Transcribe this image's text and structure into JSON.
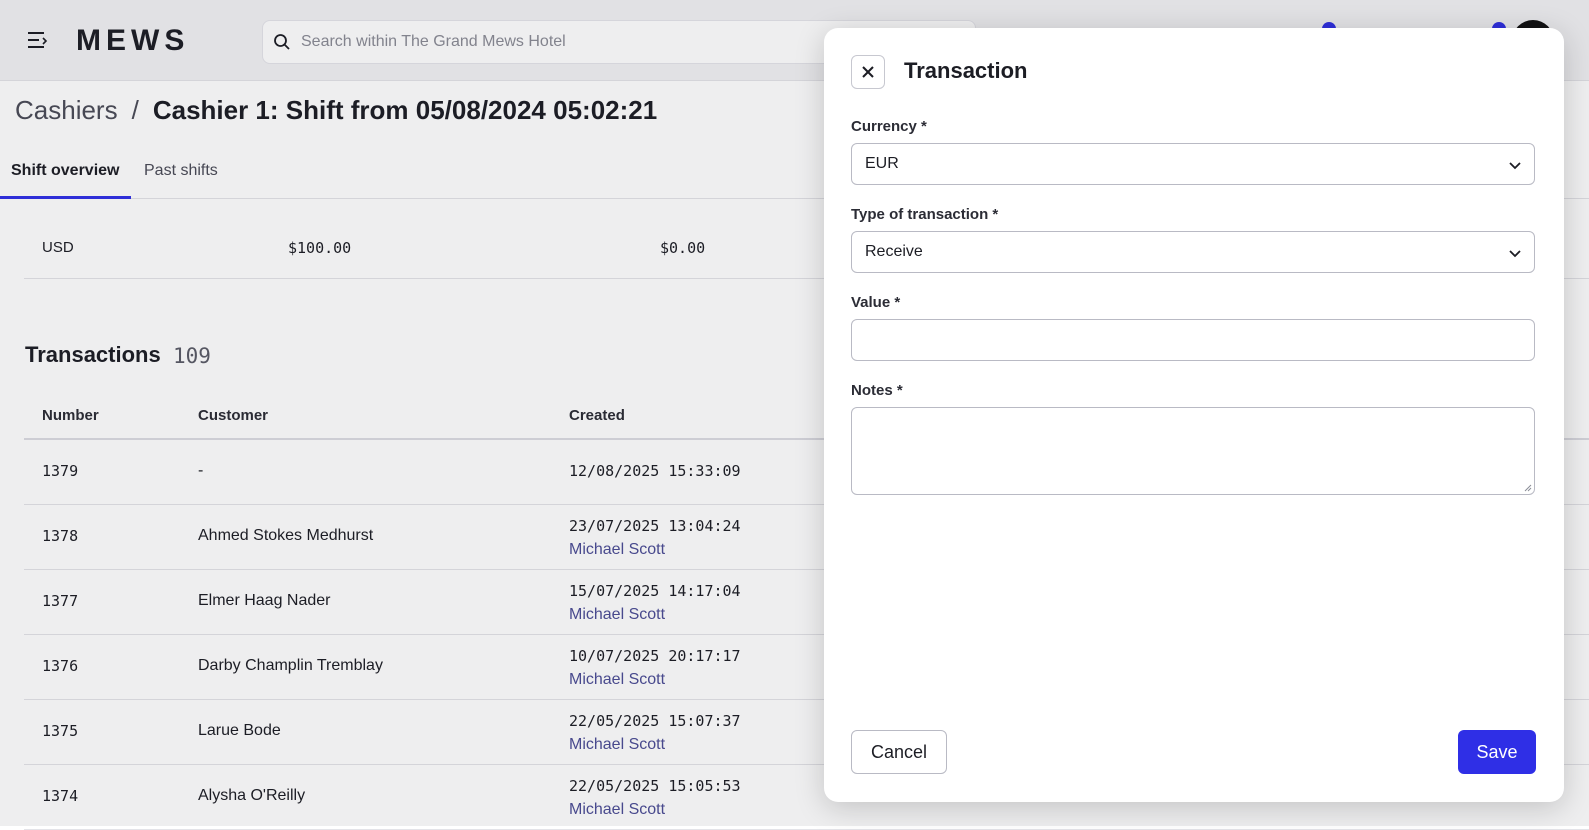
{
  "header": {
    "logo": "MEWS",
    "search_placeholder": "Search within The Grand Mews Hotel"
  },
  "breadcrumb": {
    "parent": "Cashiers",
    "separator": "/",
    "current": "Cashier 1: Shift from 05/08/2024 05:02:21"
  },
  "tabs": [
    {
      "label": "Shift overview",
      "active": true
    },
    {
      "label": "Past shifts",
      "active": false
    }
  ],
  "currency_row": {
    "currency": "USD",
    "amount_1": "$100.00",
    "amount_2": "$0.00"
  },
  "transactions": {
    "title": "Transactions",
    "count": "109",
    "columns": [
      "Number",
      "Customer",
      "Created"
    ],
    "rows": [
      {
        "number": "1379",
        "customer": "-",
        "created": "12/08/2025 15:33:09",
        "user": ""
      },
      {
        "number": "1378",
        "customer": "Ahmed Stokes Medhurst",
        "created": "23/07/2025 13:04:24",
        "user": "Michael Scott"
      },
      {
        "number": "1377",
        "customer": "Elmer Haag Nader",
        "created": "15/07/2025 14:17:04",
        "user": "Michael Scott"
      },
      {
        "number": "1376",
        "customer": "Darby Champlin Tremblay",
        "created": "10/07/2025 20:17:17",
        "user": "Michael Scott"
      },
      {
        "number": "1375",
        "customer": "Larue Bode",
        "created": "22/05/2025 15:07:37",
        "user": "Michael Scott"
      },
      {
        "number": "1374",
        "customer": "Alysha O'Reilly",
        "created": "22/05/2025 15:05:53",
        "user": "Michael Scott"
      }
    ]
  },
  "panel": {
    "title": "Transaction",
    "currency_label": "Currency *",
    "currency_value": "EUR",
    "type_label": "Type of transaction *",
    "type_value": "Receive",
    "value_label": "Value *",
    "value_value": "",
    "notes_label": "Notes *",
    "notes_value": "",
    "cancel_label": "Cancel",
    "save_label": "Save"
  },
  "colors": {
    "accent": "#2f2fe6",
    "link": "#4b4c95"
  },
  "icons": [
    "menu-icon",
    "search-icon",
    "close-icon",
    "chevron-down-icon"
  ]
}
